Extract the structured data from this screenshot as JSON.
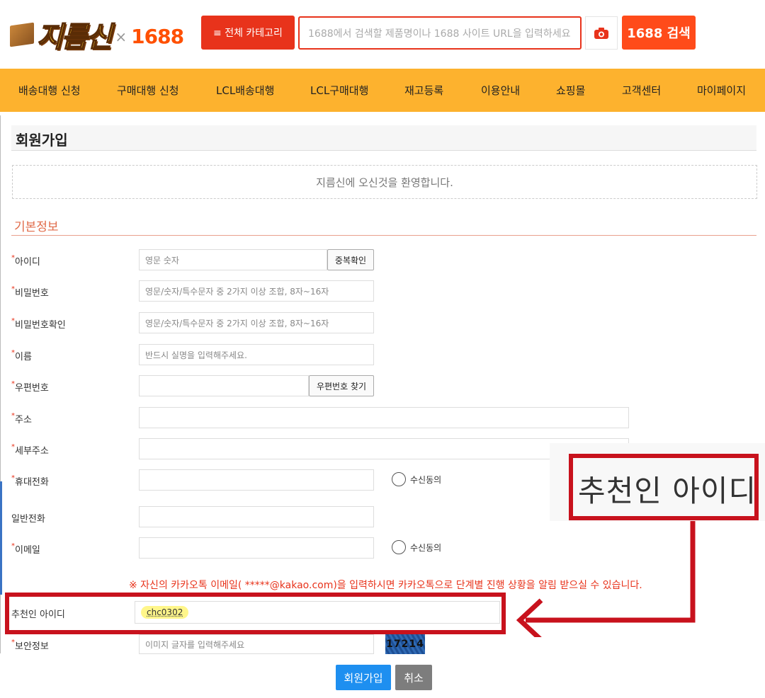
{
  "header": {
    "logo_text": "지름신",
    "logo_x": "×",
    "logo_partner": "1688",
    "category_button": "≡ 전체 카테고리",
    "search_placeholder": "1688에서 검색할 제품명이나 1688 사이트 URL을 입력하세요",
    "camera_icon": "camera-icon",
    "search_button": "1688 검색"
  },
  "nav": {
    "items": [
      "배송대행 신청",
      "구매대행 신청",
      "LCL배송대행",
      "LCL구매대행",
      "재고등록",
      "이용안내",
      "쇼핑몰",
      "고객센터",
      "마이페이지"
    ]
  },
  "page": {
    "title": "회원가입",
    "welcome": "지름신에 오신것을 환영합니다.",
    "section": "기본정보"
  },
  "form": {
    "required_mark": "*",
    "id_label": "아이디",
    "id_placeholder": "영문 숫자",
    "id_check_button": "중복확인",
    "password_label": "비밀번호",
    "password_placeholder": "영문/숫자/특수문자 중 2가지 이상 조합, 8자~16자",
    "password_confirm_label": "비밀번호확인",
    "password_confirm_placeholder": "영문/숫자/특수문자 중 2가지 이상 조합, 8자~16자",
    "name_label": "이름",
    "name_placeholder": "반드시 실명을 입력해주세요.",
    "zip_label": "우편번호",
    "zip_button": "우편번호 찾기",
    "address_label": "주소",
    "detail_address_label": "세부주소",
    "mobile_label": "휴대전화",
    "mobile_consent": "수신동의",
    "phone_label": "일반전화",
    "email_label": "이메일",
    "email_consent": "수신동의",
    "kakao_notice": "※ 자신의 카카오톡 이메일( *****@kakao.com)을 입력하시면 카카오톡으로 단계별 진행 상황을 알림 받으실 수 있습니다.",
    "referrer_label": "추천인 아이디",
    "referrer_value": "chc0302",
    "security_label": "보안정보",
    "security_placeholder": "이미지 글자를 입력해주세요",
    "captcha_text": "17214",
    "submit_button": "회원가입",
    "cancel_button": "취소"
  },
  "annotation": {
    "zoom_label": "추천인 아이디",
    "color": "#c8121d"
  }
}
